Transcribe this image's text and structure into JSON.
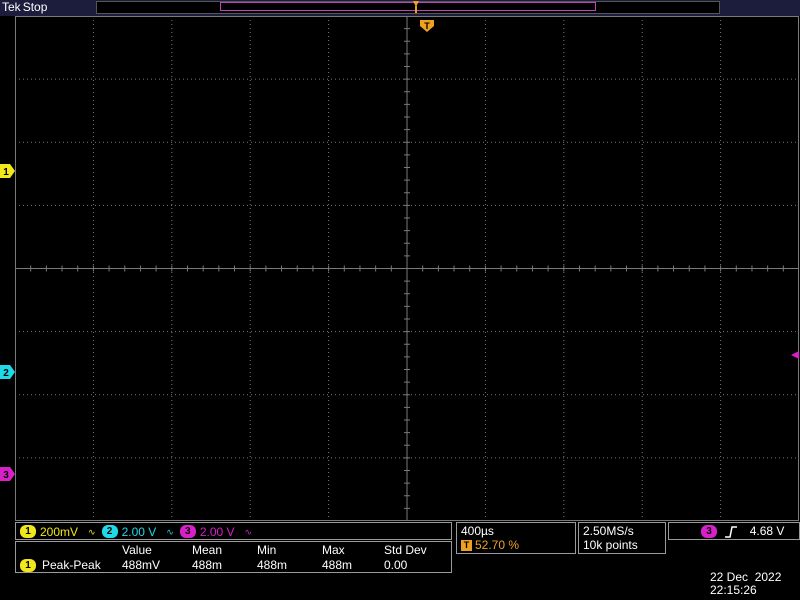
{
  "header": {
    "brand": "Tek",
    "acq_state": "Stop"
  },
  "display": {
    "trigger_marker": "T",
    "grid_color": "#7a7a7a",
    "channels": [
      {
        "id": "1",
        "color": "#f0e81c"
      },
      {
        "id": "2",
        "color": "#1fd8e8"
      },
      {
        "id": "3",
        "color": "#d820c8"
      }
    ]
  },
  "vertical": {
    "ch1": {
      "label": "1",
      "scale": "200mV",
      "bw_icon": "bandwidth-limit-icon"
    },
    "ch2": {
      "label": "2",
      "scale": "2.00 V",
      "bw_icon": "bandwidth-limit-icon"
    },
    "ch3": {
      "label": "3",
      "scale": "2.00 V",
      "bw_icon": "bandwidth-limit-icon"
    }
  },
  "horizontal": {
    "timebase": "400µs",
    "trigger_position": "52.70 %"
  },
  "acquisition": {
    "sample_rate": "2.50MS/s",
    "record_length": "10k points"
  },
  "trigger": {
    "source": "3",
    "slope_icon": "rising-edge-icon",
    "level": "4.68 V"
  },
  "measurements": {
    "headers": {
      "value": "Value",
      "mean": "Mean",
      "min": "Min",
      "max": "Max",
      "std": "Std Dev"
    },
    "row": {
      "source": "1",
      "name": "Peak-Peak",
      "value": "488mV",
      "mean": "488m",
      "min": "488m",
      "max": "488m",
      "std": "0.00"
    }
  },
  "datetime": {
    "date": "22 Dec  2022",
    "time": "22:15:26"
  }
}
